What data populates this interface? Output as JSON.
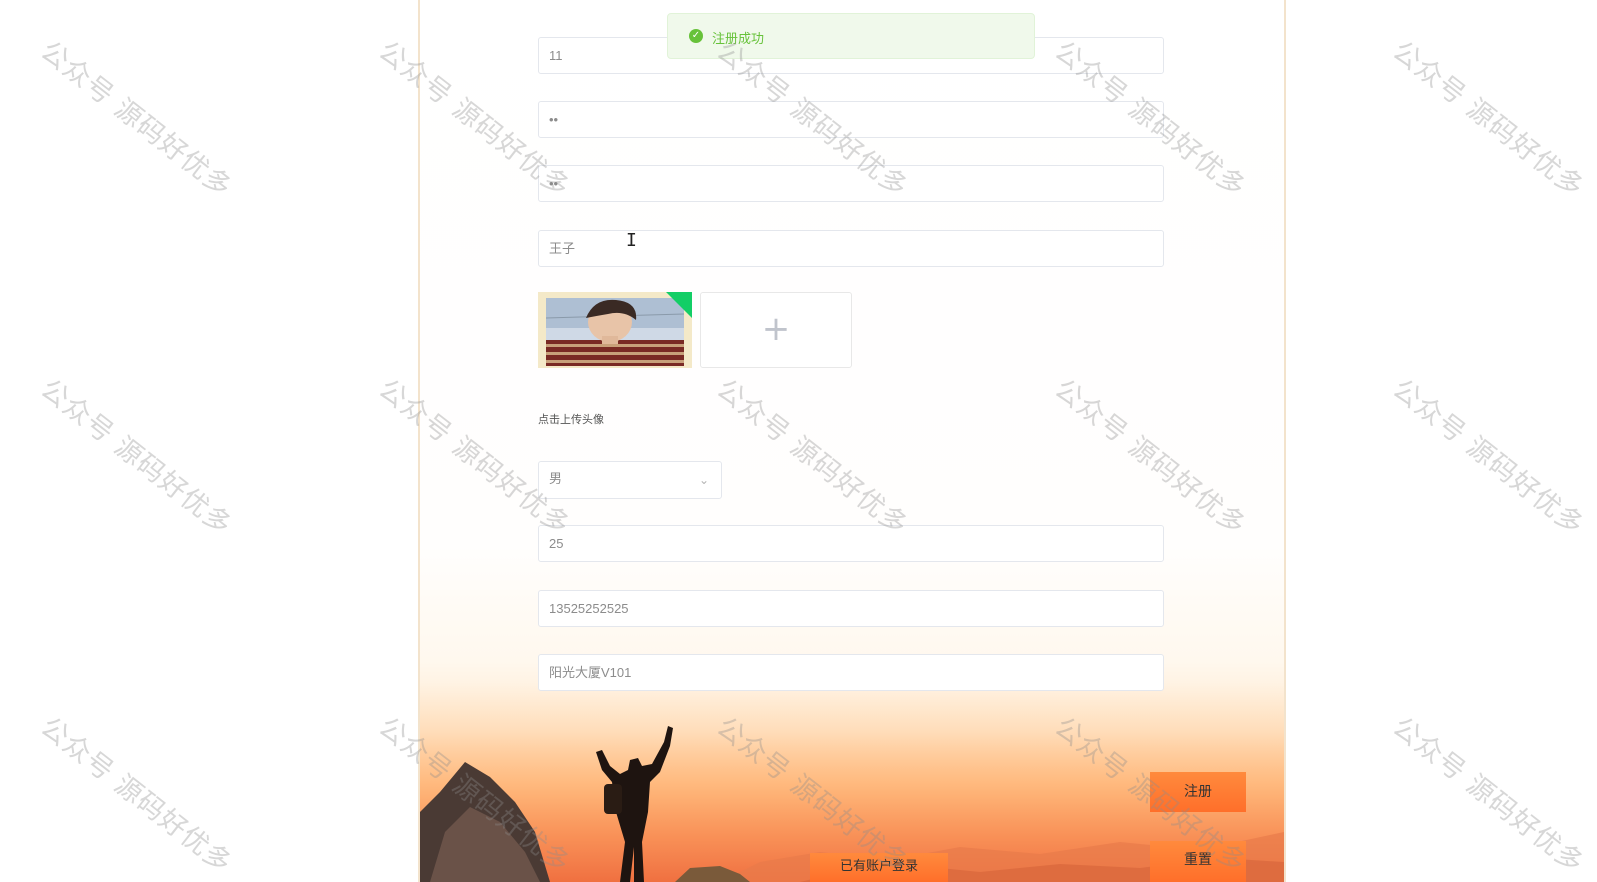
{
  "notification": {
    "message": "注册成功",
    "icon": "success-check-icon",
    "color": "#67c23a"
  },
  "form": {
    "username_value": "11",
    "password_value": "••",
    "confirm_password_value": "••",
    "name_value": "王子",
    "avatar_hint": "点击上传头像",
    "gender_selected": "男",
    "age_value": "25",
    "phone_value": "13525252525",
    "address_value": "阳光大厦V101"
  },
  "buttons": {
    "register_label": "注册",
    "reset_label": "重置",
    "login_link_label": "已有账户登录"
  },
  "watermark_text": "公众号 源码好优多",
  "colors": {
    "accent_orange": "#ff7a33",
    "success_green": "#13ce66",
    "panel_border": "#f3e3cc"
  }
}
